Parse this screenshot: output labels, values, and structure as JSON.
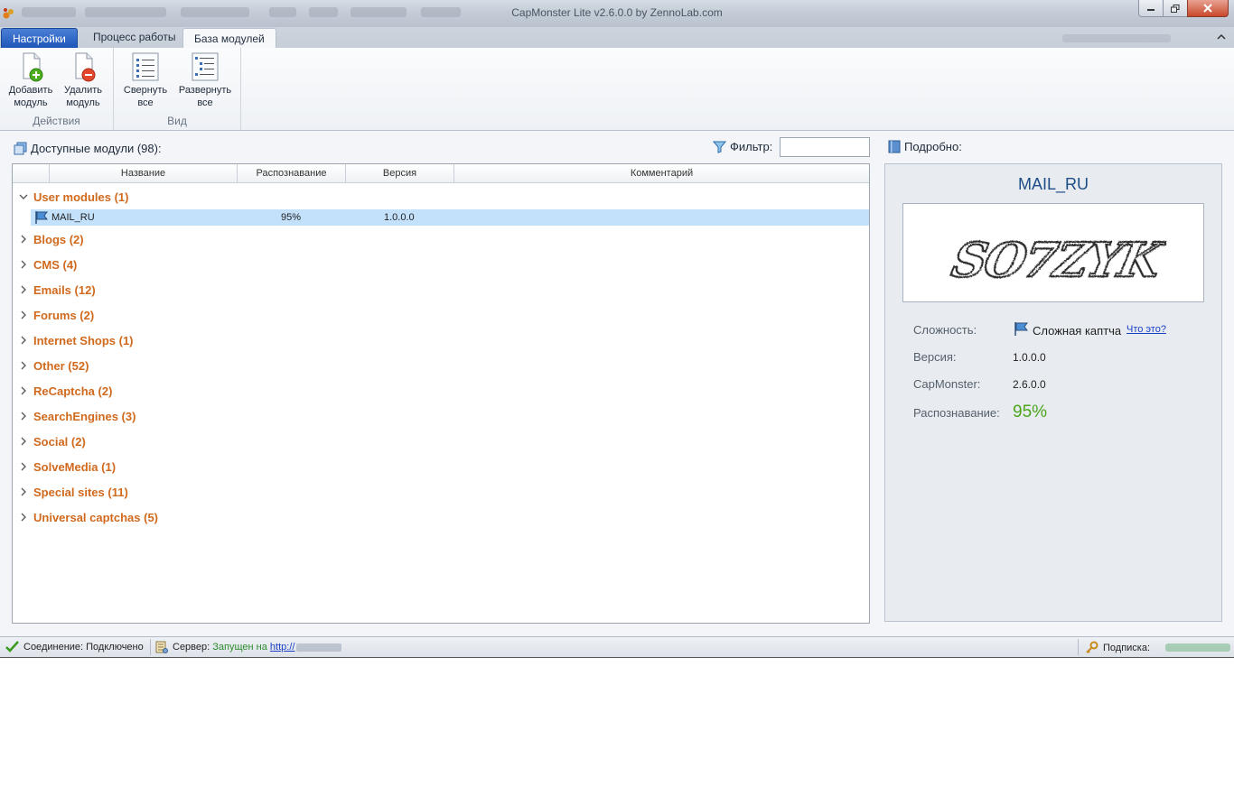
{
  "window": {
    "title": "CapMonster Lite v2.6.0.0 by ZennoLab.com"
  },
  "tabs": [
    {
      "label": "Настройки"
    },
    {
      "label": "Процесс работы"
    },
    {
      "label": "База модулей"
    }
  ],
  "ribbon": {
    "groups": [
      {
        "label": "Действия",
        "buttons": [
          {
            "label": "Добавить модуль"
          },
          {
            "label": "Удалить модуль"
          }
        ]
      },
      {
        "label": "Вид",
        "buttons": [
          {
            "label": "Свернуть все"
          },
          {
            "label": "Развернуть все"
          }
        ]
      }
    ],
    "add_line1": "Добавить",
    "add_line2": "модуль",
    "del_line1": "Удалить",
    "del_line2": "модуль",
    "collapse_line1": "Свернуть",
    "collapse_line2": "все",
    "expand_line1": "Развернуть",
    "expand_line2": "все"
  },
  "modules": {
    "header": "Доступные модули (98):",
    "filter_label": "Фильтр:",
    "filter_value": "",
    "columns": [
      "Название",
      "Распознавание",
      "Версия",
      "Комментарий"
    ],
    "groups": [
      "User modules (1)",
      "Blogs (2)",
      "CMS (4)",
      "Emails (12)",
      "Forums (2)",
      "Internet Shops (1)",
      "Other (52)",
      "ReCaptcha (2)",
      "SearchEngines (3)",
      "Social (2)",
      "SolveMedia (1)",
      "Special sites (11)",
      "Universal captchas (5)"
    ],
    "selected_row": {
      "name": "MAIL_RU",
      "recognition": "95%",
      "version": "1.0.0.0",
      "comment": ""
    }
  },
  "details": {
    "header": "Подробно:",
    "title": "MAIL_RU",
    "captcha_text": "SO7ZYK",
    "difficulty_label": "Сложность:",
    "difficulty_value": "Сложная каптча",
    "what_is_it": "Что это?",
    "version_label": "Версия:",
    "version_value": "1.0.0.0",
    "capmonster_label": "CapMonster:",
    "capmonster_value": "2.6.0.0",
    "recognition_label": "Распознавание:",
    "recognition_value": "95%"
  },
  "status": {
    "connection": "Соединение: Подключено",
    "server_label": "Сервер:",
    "server_state": "Запущен на",
    "server_link": "http://",
    "subscription_label": "Подписка:"
  },
  "colors": {
    "accent": "#1f56b8",
    "group_text": "#d1691d",
    "selection": "#c3e1fb",
    "recognition_green": "#4aa51b",
    "details_title": "#1e4d86"
  }
}
